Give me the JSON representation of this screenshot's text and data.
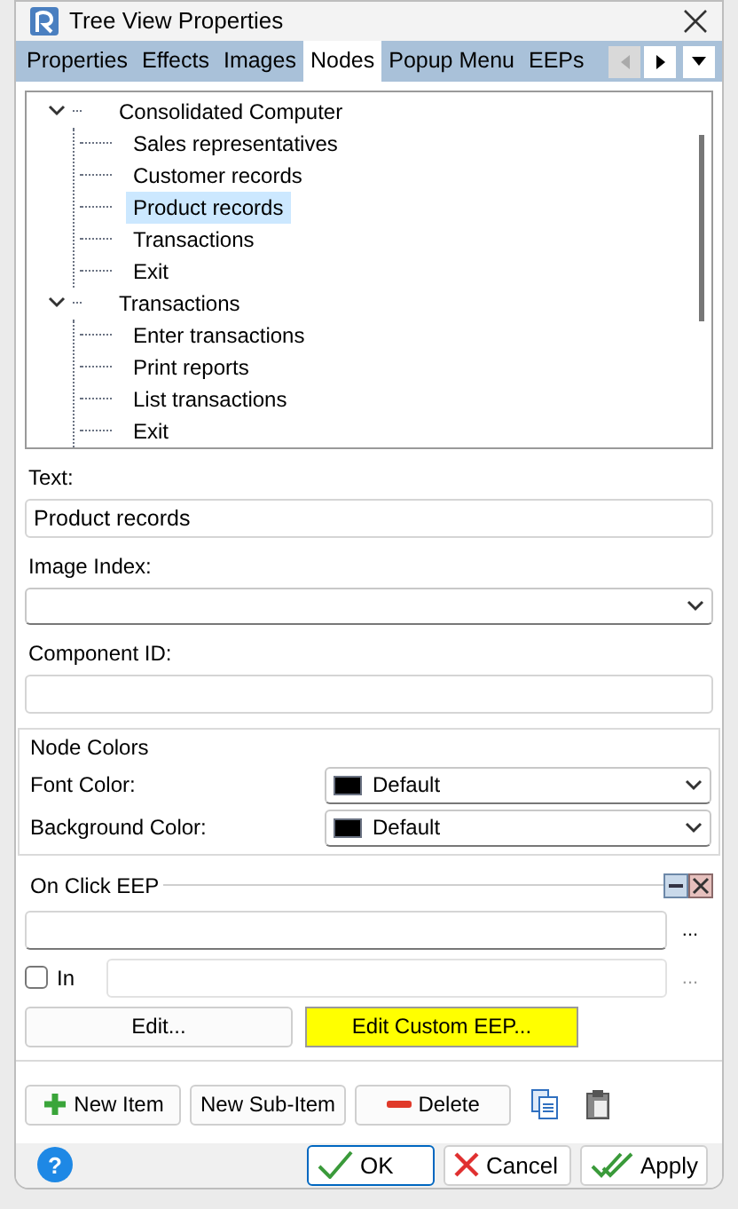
{
  "window": {
    "title": "Tree View Properties"
  },
  "tabs": [
    {
      "label": "Properties",
      "selected": false
    },
    {
      "label": "Effects",
      "selected": false
    },
    {
      "label": "Images",
      "selected": false
    },
    {
      "label": "Nodes",
      "selected": true
    },
    {
      "label": "Popup Menu",
      "selected": false
    },
    {
      "label": "EEPs",
      "selected": false
    }
  ],
  "tree": [
    {
      "label": "Consolidated Computer",
      "expanded": true,
      "selected": false,
      "children": [
        {
          "label": "Sales representatives",
          "selected": false
        },
        {
          "label": "Customer records",
          "selected": false
        },
        {
          "label": "Product records",
          "selected": true
        },
        {
          "label": "Transactions",
          "selected": false
        },
        {
          "label": "Exit",
          "selected": false
        }
      ]
    },
    {
      "label": "Transactions",
      "expanded": true,
      "selected": false,
      "children": [
        {
          "label": "Enter transactions",
          "selected": false
        },
        {
          "label": "Print reports",
          "selected": false
        },
        {
          "label": "List transactions",
          "selected": false
        },
        {
          "label": "Exit",
          "selected": false
        }
      ]
    }
  ],
  "fields": [
    {
      "kind": "text",
      "label": "Text:",
      "value": "Product records"
    },
    {
      "kind": "select",
      "label": "Image Index:"
    },
    {
      "kind": "text",
      "label": "Component ID:"
    }
  ],
  "node_colors": {
    "title": "Node Colors",
    "rows": [
      {
        "label": "Font Color:",
        "value": "Default",
        "color": "#000000"
      },
      {
        "label": "Background Color:",
        "value": "Default",
        "color": "#000000"
      }
    ]
  },
  "on_click_eep": {
    "title": "On Click EEP",
    "in_label": "In",
    "in_checked": false,
    "ellipsis": [
      "...",
      "..."
    ],
    "edit_button": "Edit...",
    "custom_button": "Edit Custom EEP..."
  },
  "item_buttons": [
    {
      "kind": "add",
      "label": "New Item"
    },
    {
      "kind": "plain",
      "label": "New Sub-Item"
    },
    {
      "kind": "remove",
      "label": "Delete"
    }
  ],
  "footer": {
    "help": "?",
    "buttons": [
      {
        "kind": "ok",
        "label": "OK",
        "selected": true
      },
      {
        "kind": "cancel",
        "label": "Cancel",
        "selected": false
      },
      {
        "kind": "apply",
        "label": "Apply",
        "selected": false
      }
    ]
  }
}
